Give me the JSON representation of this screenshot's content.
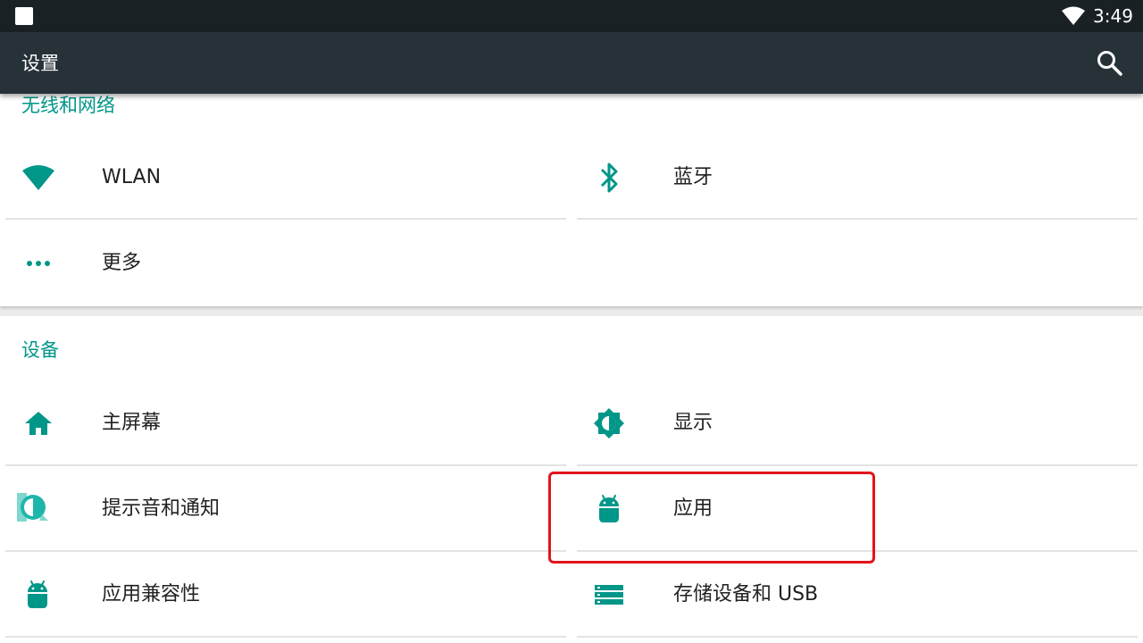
{
  "status_bar": {
    "time": "3:49",
    "icons": [
      "square-notification-icon",
      "wifi-icon"
    ]
  },
  "app_bar": {
    "title": "设置",
    "search_icon": "search-icon"
  },
  "sections": [
    {
      "header": "无线和网络",
      "items": [
        {
          "label": "WLAN",
          "icon": "wifi-icon"
        },
        {
          "label": "蓝牙",
          "icon": "bluetooth-icon"
        },
        {
          "label": "更多",
          "icon": "more-horiz-icon"
        }
      ]
    },
    {
      "header": "设备",
      "items": [
        {
          "label": "主屏幕",
          "icon": "home-icon"
        },
        {
          "label": "显示",
          "icon": "brightness-icon"
        },
        {
          "label": "提示音和通知",
          "icon": "notification-sound-icon"
        },
        {
          "label": "应用",
          "icon": "android-icon"
        },
        {
          "label": "应用兼容性",
          "icon": "android-icon"
        },
        {
          "label": "存储设备和 USB",
          "icon": "storage-icon"
        }
      ]
    }
  ],
  "colors": {
    "accent": "#009688",
    "app_bar": "#263238",
    "status_bar": "#1a2125",
    "highlight": "#e3141c"
  }
}
